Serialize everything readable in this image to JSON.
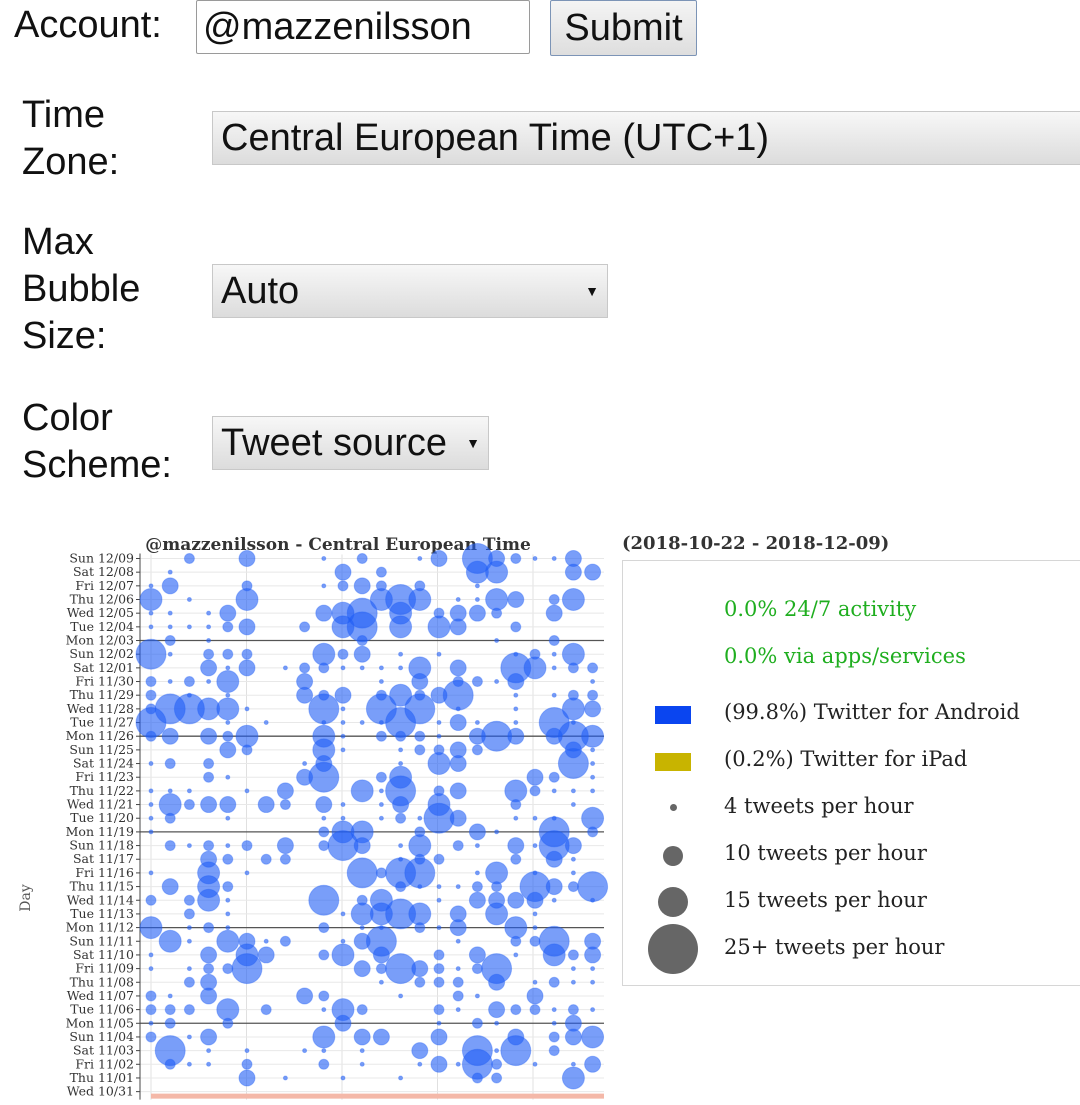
{
  "form": {
    "account_label": "Account:",
    "account_value": "@mazzenilsson",
    "submit_label": "Submit",
    "timezone_label_1": "Time",
    "timezone_label_2": "Zone:",
    "timezone_value": "Central European Time (UTC+1)",
    "bubble_label_1": "Max",
    "bubble_label_2": "Bubble",
    "bubble_label_3": "Size:",
    "bubble_value": "Auto",
    "color_label_1": "Color",
    "color_label_2": "Scheme:",
    "color_value": "Tweet source"
  },
  "chart_data": {
    "type": "scatter",
    "title": "@mazzenilsson - Central European Time",
    "date_range": "(2018-10-22 - 2018-12-09)",
    "ylabel": "Day",
    "grid": true,
    "colors": {
      "android": "#1f5ef5",
      "ipad": "#c8b400"
    },
    "days": [
      "Sun 12/09",
      "Sat 12/08",
      "Fri 12/07",
      "Thu 12/06",
      "Wed 12/05",
      "Tue 12/04",
      "Mon 12/03",
      "Sun 12/02",
      "Sat 12/01",
      "Fri 11/30",
      "Thu 11/29",
      "Wed 11/28",
      "Tue 11/27",
      "Mon 11/26",
      "Sun 11/25",
      "Sat 11/24",
      "Fri 11/23",
      "Thu 11/22",
      "Wed 11/21",
      "Tue 11/20",
      "Mon 11/19",
      "Sun 11/18",
      "Sat 11/17",
      "Fri 11/16",
      "Thu 11/15",
      "Wed 11/14",
      "Tue 11/13",
      "Mon 11/12",
      "Sun 11/11",
      "Sat 11/10",
      "Fri 11/09",
      "Thu 11/08",
      "Wed 11/07",
      "Tue 11/06",
      "Mon 11/05",
      "Sun 11/04",
      "Sat 11/03",
      "Fri 11/02",
      "Thu 11/01",
      "Wed 10/31"
    ],
    "monday_rows": [
      6,
      13,
      20,
      27,
      34
    ]
  },
  "legend": {
    "activity": "0.0% 24/7 activity",
    "apps": "0.0% via apps/services",
    "android": "(99.8%) Twitter for Android",
    "ipad": "(0.2%) Twitter for iPad",
    "size_4": "4 tweets per hour",
    "size_10": "10 tweets per hour",
    "size_15": "15 tweets per hour",
    "size_25": "25+ tweets per hour"
  }
}
